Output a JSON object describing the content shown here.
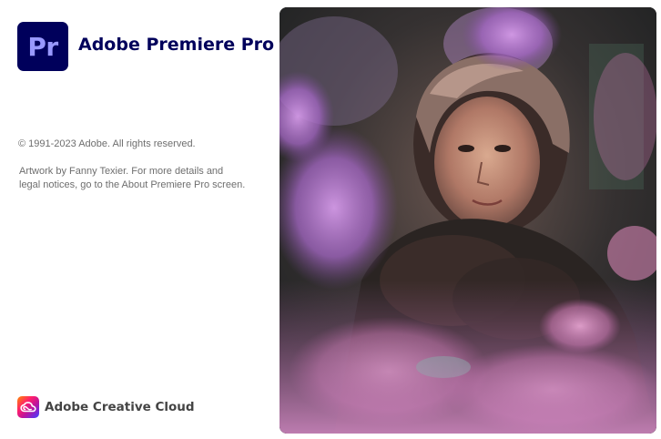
{
  "app": {
    "icon_text": "Pr",
    "title": "Adobe Premiere Pro",
    "brand_color": "#00005b",
    "icon_text_color": "#9999ff"
  },
  "legal": {
    "copyright": "© 1991-2023 Adobe. All rights reserved.",
    "credits": "Artwork by Fanny Texier. For more details and legal notices, go to the About Premiere Pro screen."
  },
  "footer": {
    "icon": "creative-cloud-icon",
    "label": "Adobe Creative Cloud"
  },
  "artwork": {
    "icon": "splash-artwork-image"
  }
}
